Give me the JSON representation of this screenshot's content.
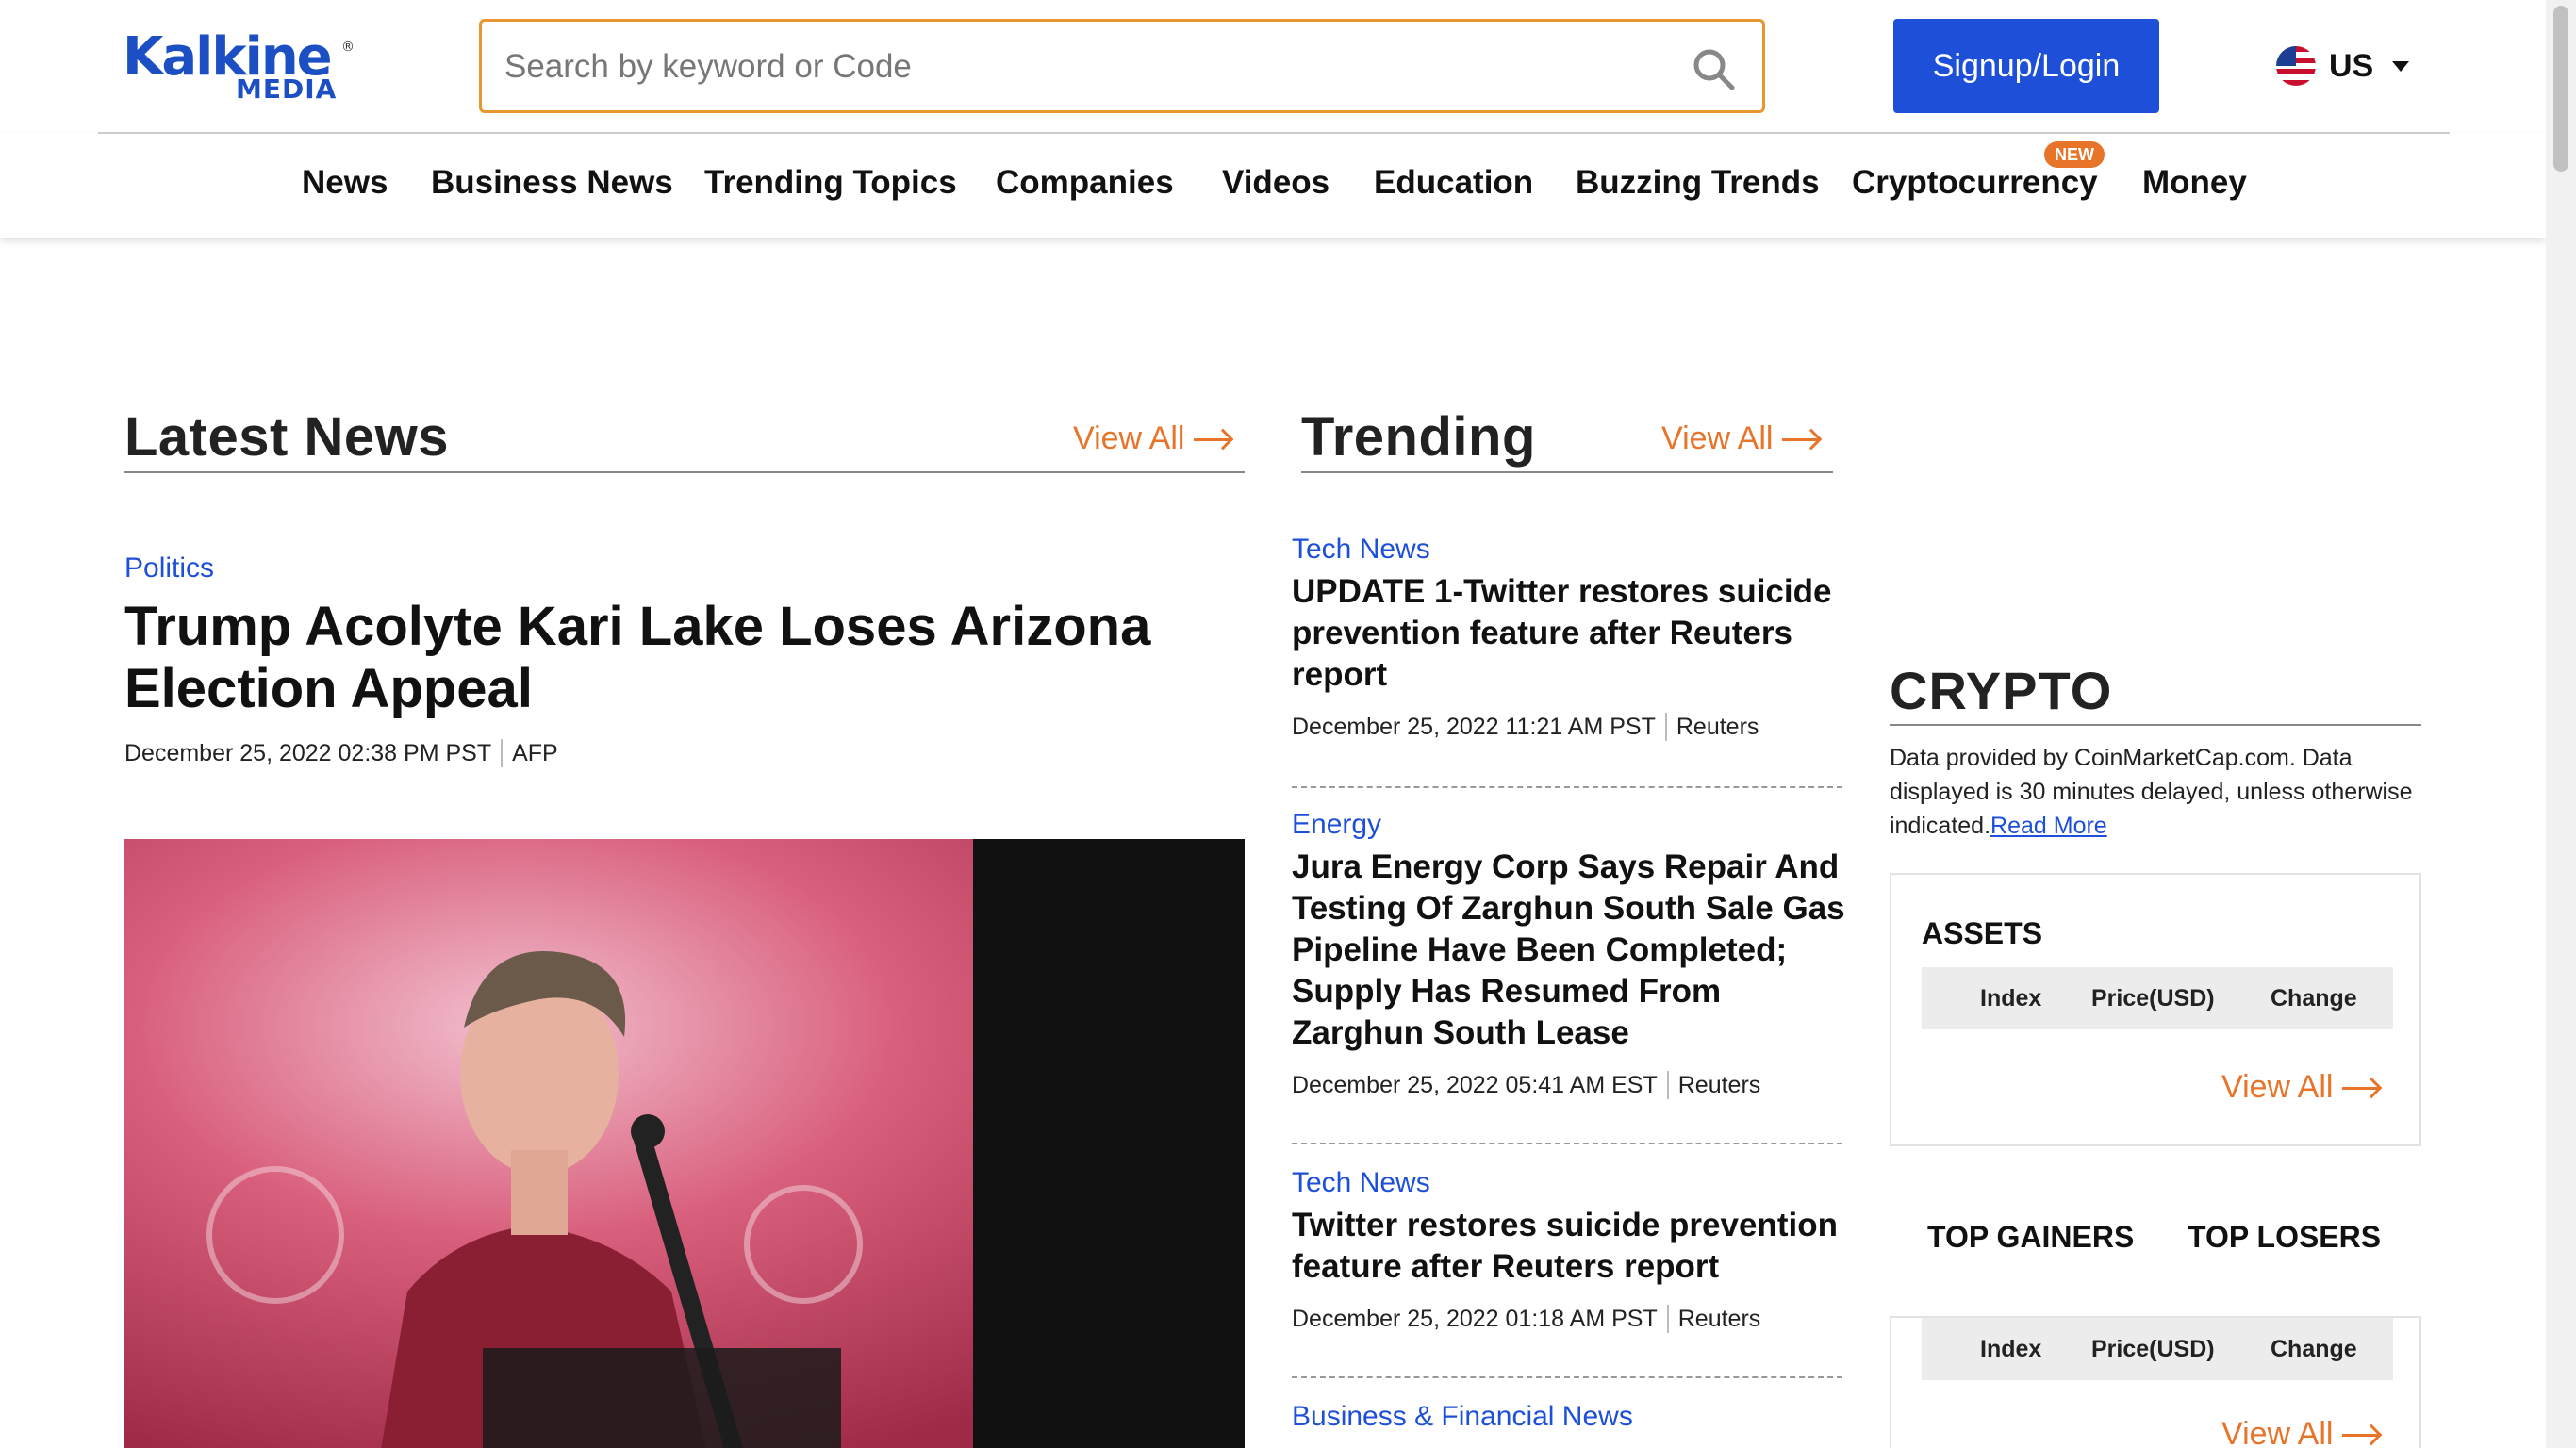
{
  "header": {
    "logo_top": "Kalkine",
    "logo_bottom": "MEDIA",
    "search_placeholder": "Search by keyword or Code",
    "signup_label": "Signup/Login",
    "region_label": "US"
  },
  "nav": {
    "items": [
      "News",
      "Business News",
      "Trending Topics",
      "Companies",
      "Videos",
      "Education",
      "Buzzing Trends",
      "Cryptocurrency",
      "Money"
    ],
    "new_badge": "NEW"
  },
  "latest": {
    "title": "Latest News",
    "view_all": "View All",
    "lead": {
      "category": "Politics",
      "headline": "Trump Acolyte Kari Lake Loses Arizona Election Appeal",
      "date": "December 25, 2022 02:38 PM PST",
      "source": "AFP"
    }
  },
  "trending": {
    "title": "Trending",
    "view_all": "View All",
    "items": [
      {
        "category": "Tech News",
        "headline": "UPDATE 1-Twitter restores suicide prevention feature after Reuters report",
        "date": "December 25, 2022 11:21 AM PST",
        "source": "Reuters"
      },
      {
        "category": "Energy",
        "headline": "Jura Energy Corp Says Repair And Testing Of Zarghun South Sale Gas Pipeline Have Been Completed; Supply Has Resumed From Zarghun South Lease",
        "date": "December 25, 2022 05:41 AM EST",
        "source": "Reuters"
      },
      {
        "category": "Tech News",
        "headline": "Twitter restores suicide prevention feature after Reuters report",
        "date": "December 25, 2022 01:18 AM PST",
        "source": "Reuters"
      },
      {
        "category": "Business & Financial News",
        "headline": "",
        "date": "",
        "source": ""
      }
    ]
  },
  "crypto": {
    "title": "CRYPTO",
    "desc_prefix": "Data provided by ",
    "desc_source": "CoinMarketCap.com",
    "desc_suffix": ". Data displayed is 30 minutes delayed, unless otherwise indicated.",
    "read_more": "Read More",
    "assets": {
      "title": "ASSETS",
      "columns": [
        "Index",
        "Price(USD)",
        "Change"
      ],
      "view_all": "View All"
    },
    "tabs": [
      "TOP GAINERS",
      "TOP LOSERS"
    ],
    "gainers": {
      "columns": [
        "Index",
        "Price(USD)",
        "Change"
      ],
      "view_all": "View All"
    }
  },
  "colors": {
    "brand_blue": "#1d4fd9",
    "accent_orange": "#e8742a"
  }
}
